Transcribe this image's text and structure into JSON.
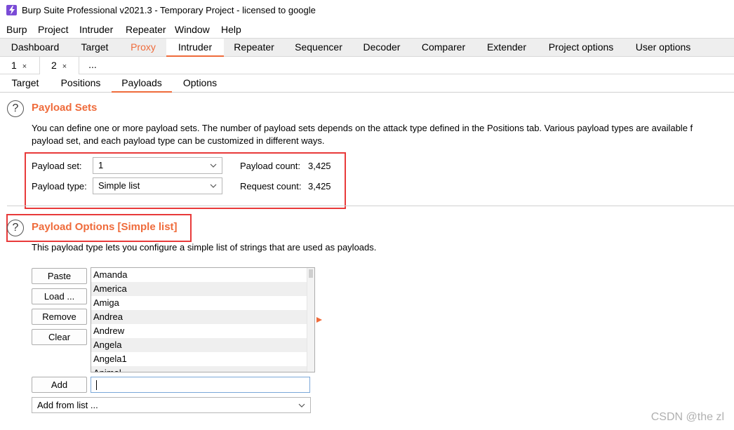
{
  "window": {
    "title": "Burp Suite Professional v2021.3 - Temporary Project - licensed to google"
  },
  "menu": {
    "items": [
      "Burp",
      "Project",
      "Intruder",
      "Repeater",
      "Window",
      "Help"
    ]
  },
  "main_tabs": {
    "items": [
      "Dashboard",
      "Target",
      "Proxy",
      "Intruder",
      "Repeater",
      "Sequencer",
      "Decoder",
      "Comparer",
      "Extender",
      "Project options",
      "User options"
    ],
    "active": "Intruder",
    "highlight_color": "#ef6b3b"
  },
  "attack_tabs": {
    "items": [
      "1",
      "2"
    ],
    "close_glyph": "×",
    "more": "...",
    "active": "2"
  },
  "intruder_tabs": {
    "items": [
      "Target",
      "Positions",
      "Payloads",
      "Options"
    ],
    "active": "Payloads"
  },
  "payload_sets": {
    "help": "?",
    "title": "Payload Sets",
    "description_line1": "You can define one or more payload sets. The number of payload sets depends on the attack type defined in the Positions tab. Various payload types are available f",
    "description_line2": "payload set, and each payload type can be customized in different ways.",
    "set_label": "Payload set:",
    "set_value": "1",
    "type_label": "Payload type:",
    "type_value": "Simple list",
    "payload_count_label": "Payload count:",
    "payload_count": "3,425",
    "request_count_label": "Request count:",
    "request_count": "3,425"
  },
  "payload_options": {
    "help": "?",
    "title": "Payload Options [Simple list]",
    "description": "This payload type lets you configure a simple list of strings that are used as payloads.",
    "buttons": {
      "paste": "Paste",
      "load": "Load ...",
      "remove": "Remove",
      "clear": "Clear",
      "add": "Add"
    },
    "list": [
      "Amanda",
      "America",
      "Amiga",
      "Andrea",
      "Andrew",
      "Angela",
      "Angela1",
      "Animal"
    ],
    "add_input_value": "",
    "add_from_list": "Add from list ..."
  },
  "watermark": "CSDN @the zl",
  "colors": {
    "accent": "#ef6b3b",
    "annotation_red": "#e83a3a"
  }
}
